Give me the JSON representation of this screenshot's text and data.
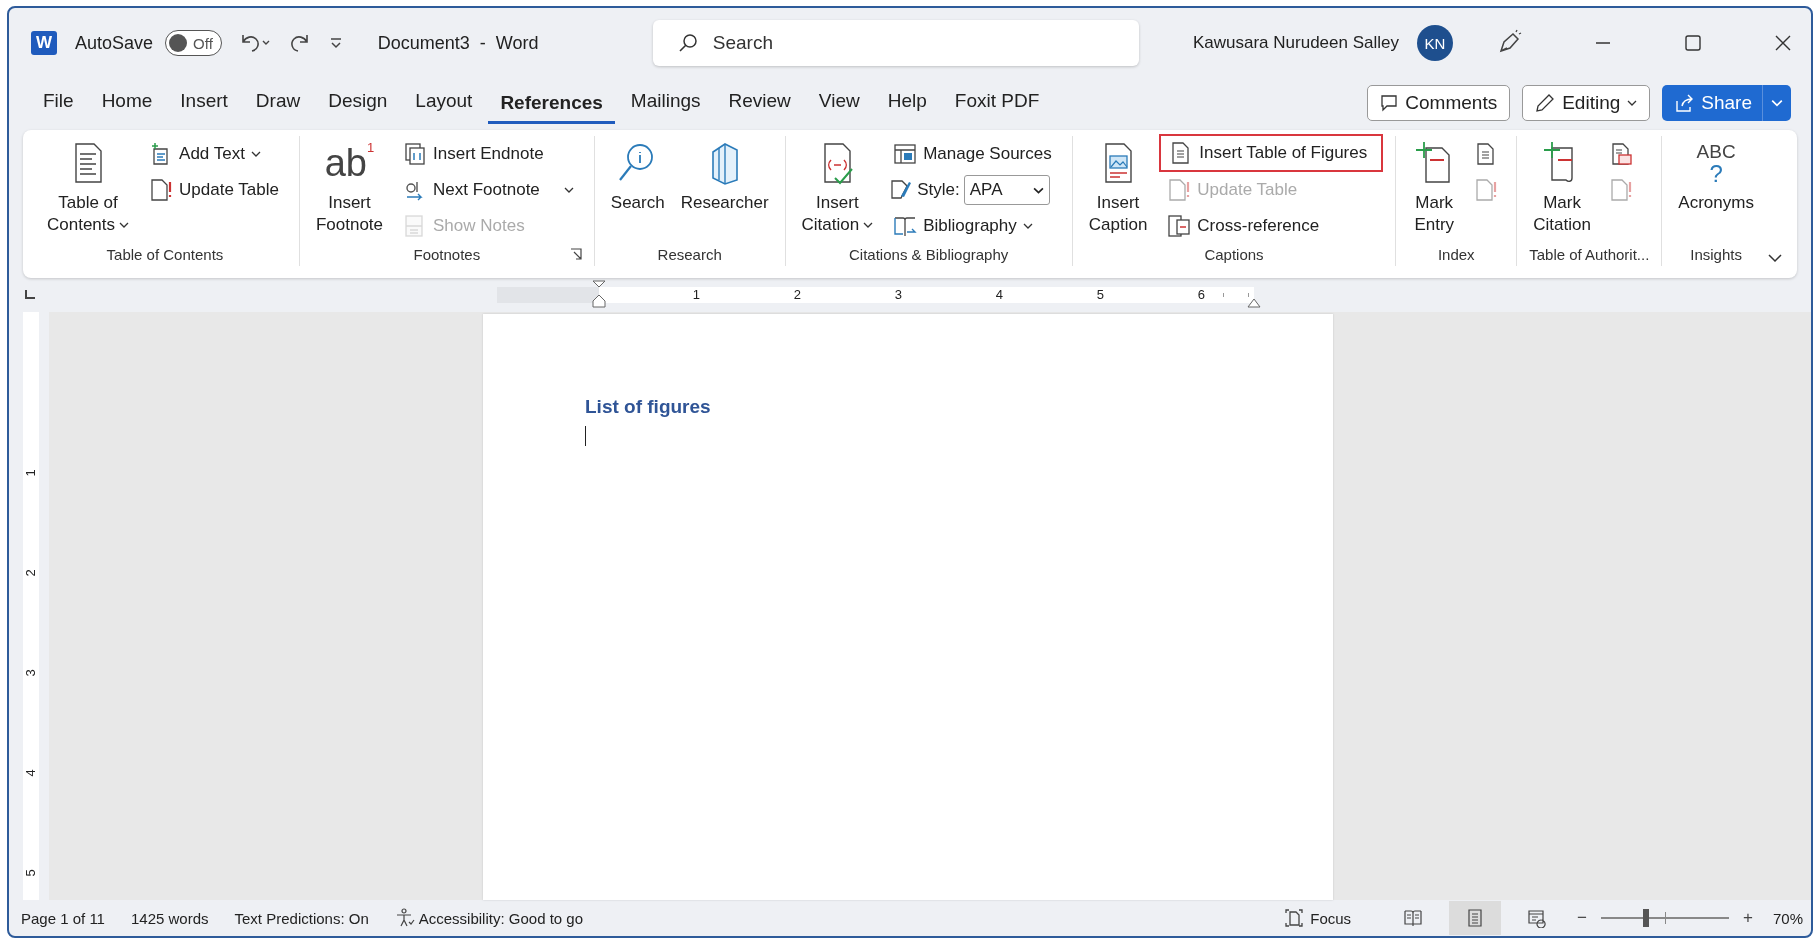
{
  "titlebar": {
    "logo_letter": "W",
    "autosave_label": "AutoSave",
    "autosave_on": false,
    "autosave_state": "Off",
    "document_title": "Document3  -  Word",
    "search_placeholder": "Search",
    "user_name": "Kawusara Nurudeen Salley",
    "user_initials": "KN"
  },
  "tabs": [
    {
      "label": "File",
      "selected": false
    },
    {
      "label": "Home",
      "selected": false
    },
    {
      "label": "Insert",
      "selected": false
    },
    {
      "label": "Draw",
      "selected": false
    },
    {
      "label": "Design",
      "selected": false
    },
    {
      "label": "Layout",
      "selected": false
    },
    {
      "label": "References",
      "selected": true
    },
    {
      "label": "Mailings",
      "selected": false
    },
    {
      "label": "Review",
      "selected": false
    },
    {
      "label": "View",
      "selected": false
    },
    {
      "label": "Help",
      "selected": false
    },
    {
      "label": "Foxit PDF",
      "selected": false
    }
  ],
  "actions": {
    "comments": "Comments",
    "editing": "Editing",
    "share": "Share"
  },
  "ribbon_groups": [
    {
      "label": "Table of Contents",
      "columns": [
        {
          "kind": "large",
          "lines": [
            "Table of",
            "Contents"
          ],
          "dropdown": true
        },
        {
          "kind": "stack",
          "items": [
            {
              "kind": "button",
              "label": "Add Text",
              "dropdown": true,
              "disabled": false,
              "highlighted": false
            },
            {
              "kind": "button",
              "label": "Update Table",
              "disabled": false,
              "highlighted": false
            }
          ]
        }
      ]
    },
    {
      "label": "Footnotes",
      "launcher": true,
      "columns": [
        {
          "kind": "large",
          "lines": [
            "Insert",
            "Footnote"
          ],
          "icon_text": "ab",
          "icon_sup": "1"
        },
        {
          "kind": "stack",
          "items": [
            {
              "kind": "button",
              "label": "Insert Endnote",
              "disabled": false,
              "highlighted": false
            },
            {
              "kind": "button",
              "label": "Next Footnote",
              "dropdown": true,
              "disabled": false,
              "highlighted": false
            },
            {
              "kind": "button",
              "label": "Show Notes",
              "disabled": true,
              "highlighted": false
            }
          ]
        }
      ]
    },
    {
      "label": "Research",
      "columns": [
        {
          "kind": "large",
          "lines": [
            "Search"
          ]
        },
        {
          "kind": "large",
          "lines": [
            "Researcher"
          ]
        }
      ]
    },
    {
      "label": "Citations & Bibliography",
      "columns": [
        {
          "kind": "large",
          "lines": [
            "Insert",
            "Citation"
          ],
          "dropdown": true
        },
        {
          "kind": "stack",
          "items": [
            {
              "kind": "button",
              "label": "Manage Sources",
              "disabled": false,
              "highlighted": false
            },
            {
              "kind": "select",
              "label": "Style:",
              "value": "APA"
            },
            {
              "kind": "button",
              "label": "Bibliography",
              "dropdown": true,
              "disabled": false,
              "highlighted": false
            }
          ]
        }
      ]
    },
    {
      "label": "Captions",
      "columns": [
        {
          "kind": "large",
          "lines": [
            "Insert",
            "Caption"
          ]
        },
        {
          "kind": "stack",
          "items": [
            {
              "kind": "button",
              "label": "Insert Table of Figures",
              "disabled": false,
              "highlighted": true
            },
            {
              "kind": "button",
              "label": "Update Table",
              "disabled": true,
              "highlighted": false
            },
            {
              "kind": "button",
              "label": "Cross-reference",
              "disabled": false,
              "highlighted": false
            }
          ]
        }
      ]
    },
    {
      "label": "Index",
      "columns": [
        {
          "kind": "large",
          "lines": [
            "Mark",
            "Entry"
          ]
        },
        {
          "kind": "stack",
          "items": [
            {
              "kind": "icon",
              "disabled": false
            },
            {
              "kind": "icon",
              "disabled": true
            }
          ]
        }
      ]
    },
    {
      "label": "Table of Authorit...",
      "columns": [
        {
          "kind": "large",
          "lines": [
            "Mark",
            "Citation"
          ]
        },
        {
          "kind": "stack",
          "items": [
            {
              "kind": "icon",
              "disabled": false
            },
            {
              "kind": "icon",
              "disabled": true
            }
          ]
        }
      ]
    },
    {
      "label": "Insights",
      "columns": [
        {
          "kind": "large",
          "lines": [
            "Acronyms"
          ],
          "icon_text": "ABC",
          "icon_sup": "?"
        }
      ]
    }
  ],
  "ruler": {
    "marks": [
      "1",
      "2",
      "3",
      "4",
      "5",
      "6"
    ],
    "vertical_marks": [
      "1",
      "2",
      "3",
      "4",
      "5"
    ]
  },
  "document": {
    "heading": "List of figures"
  },
  "status_bar": {
    "items": [
      "Page 1 of 11",
      "1425 words",
      "Text Predictions: On"
    ],
    "accessibility": "Accessibility: Good to go",
    "focus": "Focus",
    "views": [
      {
        "selected": false
      },
      {
        "selected": true
      },
      {
        "selected": false
      }
    ],
    "zoom_out": "−",
    "zoom_in": "+",
    "zoom": {
      "level": 0.35
    },
    "zoom_reading": "70%"
  }
}
